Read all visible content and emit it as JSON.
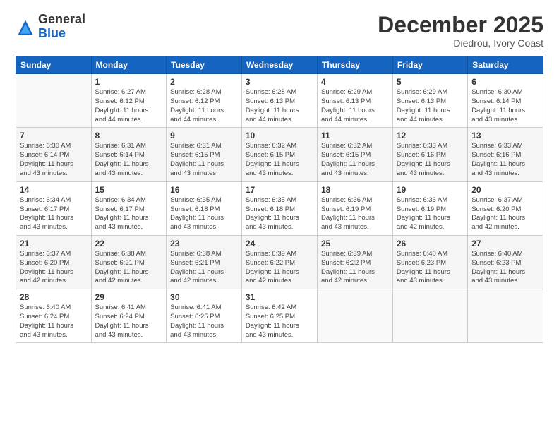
{
  "logo": {
    "general": "General",
    "blue": "Blue"
  },
  "title": "December 2025",
  "location": "Diedrou, Ivory Coast",
  "headers": [
    "Sunday",
    "Monday",
    "Tuesday",
    "Wednesday",
    "Thursday",
    "Friday",
    "Saturday"
  ],
  "weeks": [
    [
      {
        "num": "",
        "info": ""
      },
      {
        "num": "1",
        "info": "Sunrise: 6:27 AM\nSunset: 6:12 PM\nDaylight: 11 hours\nand 44 minutes."
      },
      {
        "num": "2",
        "info": "Sunrise: 6:28 AM\nSunset: 6:12 PM\nDaylight: 11 hours\nand 44 minutes."
      },
      {
        "num": "3",
        "info": "Sunrise: 6:28 AM\nSunset: 6:13 PM\nDaylight: 11 hours\nand 44 minutes."
      },
      {
        "num": "4",
        "info": "Sunrise: 6:29 AM\nSunset: 6:13 PM\nDaylight: 11 hours\nand 44 minutes."
      },
      {
        "num": "5",
        "info": "Sunrise: 6:29 AM\nSunset: 6:13 PM\nDaylight: 11 hours\nand 44 minutes."
      },
      {
        "num": "6",
        "info": "Sunrise: 6:30 AM\nSunset: 6:14 PM\nDaylight: 11 hours\nand 43 minutes."
      }
    ],
    [
      {
        "num": "7",
        "info": "Sunrise: 6:30 AM\nSunset: 6:14 PM\nDaylight: 11 hours\nand 43 minutes."
      },
      {
        "num": "8",
        "info": "Sunrise: 6:31 AM\nSunset: 6:14 PM\nDaylight: 11 hours\nand 43 minutes."
      },
      {
        "num": "9",
        "info": "Sunrise: 6:31 AM\nSunset: 6:15 PM\nDaylight: 11 hours\nand 43 minutes."
      },
      {
        "num": "10",
        "info": "Sunrise: 6:32 AM\nSunset: 6:15 PM\nDaylight: 11 hours\nand 43 minutes."
      },
      {
        "num": "11",
        "info": "Sunrise: 6:32 AM\nSunset: 6:15 PM\nDaylight: 11 hours\nand 43 minutes."
      },
      {
        "num": "12",
        "info": "Sunrise: 6:33 AM\nSunset: 6:16 PM\nDaylight: 11 hours\nand 43 minutes."
      },
      {
        "num": "13",
        "info": "Sunrise: 6:33 AM\nSunset: 6:16 PM\nDaylight: 11 hours\nand 43 minutes."
      }
    ],
    [
      {
        "num": "14",
        "info": "Sunrise: 6:34 AM\nSunset: 6:17 PM\nDaylight: 11 hours\nand 43 minutes."
      },
      {
        "num": "15",
        "info": "Sunrise: 6:34 AM\nSunset: 6:17 PM\nDaylight: 11 hours\nand 43 minutes."
      },
      {
        "num": "16",
        "info": "Sunrise: 6:35 AM\nSunset: 6:18 PM\nDaylight: 11 hours\nand 43 minutes."
      },
      {
        "num": "17",
        "info": "Sunrise: 6:35 AM\nSunset: 6:18 PM\nDaylight: 11 hours\nand 43 minutes."
      },
      {
        "num": "18",
        "info": "Sunrise: 6:36 AM\nSunset: 6:19 PM\nDaylight: 11 hours\nand 43 minutes."
      },
      {
        "num": "19",
        "info": "Sunrise: 6:36 AM\nSunset: 6:19 PM\nDaylight: 11 hours\nand 42 minutes."
      },
      {
        "num": "20",
        "info": "Sunrise: 6:37 AM\nSunset: 6:20 PM\nDaylight: 11 hours\nand 42 minutes."
      }
    ],
    [
      {
        "num": "21",
        "info": "Sunrise: 6:37 AM\nSunset: 6:20 PM\nDaylight: 11 hours\nand 42 minutes."
      },
      {
        "num": "22",
        "info": "Sunrise: 6:38 AM\nSunset: 6:21 PM\nDaylight: 11 hours\nand 42 minutes."
      },
      {
        "num": "23",
        "info": "Sunrise: 6:38 AM\nSunset: 6:21 PM\nDaylight: 11 hours\nand 42 minutes."
      },
      {
        "num": "24",
        "info": "Sunrise: 6:39 AM\nSunset: 6:22 PM\nDaylight: 11 hours\nand 42 minutes."
      },
      {
        "num": "25",
        "info": "Sunrise: 6:39 AM\nSunset: 6:22 PM\nDaylight: 11 hours\nand 42 minutes."
      },
      {
        "num": "26",
        "info": "Sunrise: 6:40 AM\nSunset: 6:23 PM\nDaylight: 11 hours\nand 43 minutes."
      },
      {
        "num": "27",
        "info": "Sunrise: 6:40 AM\nSunset: 6:23 PM\nDaylight: 11 hours\nand 43 minutes."
      }
    ],
    [
      {
        "num": "28",
        "info": "Sunrise: 6:40 AM\nSunset: 6:24 PM\nDaylight: 11 hours\nand 43 minutes."
      },
      {
        "num": "29",
        "info": "Sunrise: 6:41 AM\nSunset: 6:24 PM\nDaylight: 11 hours\nand 43 minutes."
      },
      {
        "num": "30",
        "info": "Sunrise: 6:41 AM\nSunset: 6:25 PM\nDaylight: 11 hours\nand 43 minutes."
      },
      {
        "num": "31",
        "info": "Sunrise: 6:42 AM\nSunset: 6:25 PM\nDaylight: 11 hours\nand 43 minutes."
      },
      {
        "num": "",
        "info": ""
      },
      {
        "num": "",
        "info": ""
      },
      {
        "num": "",
        "info": ""
      }
    ]
  ]
}
